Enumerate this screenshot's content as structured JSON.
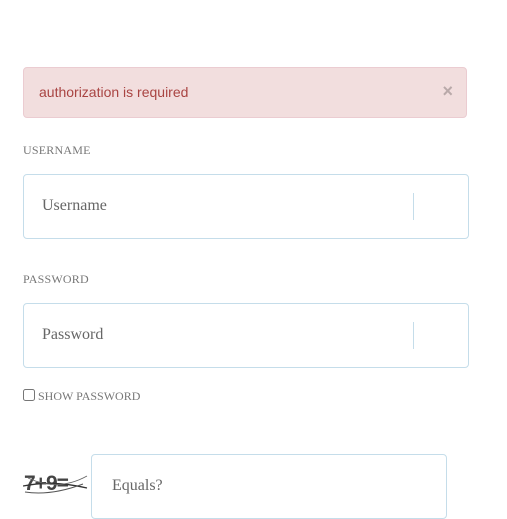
{
  "alert": {
    "message": "authorization is required",
    "close_symbol": "×",
    "background_color": "#f2dede",
    "text_color": "#a94442"
  },
  "username": {
    "label": "USERNAME",
    "placeholder": "Username",
    "value": ""
  },
  "password": {
    "label": "PASSWORD",
    "placeholder": "Password",
    "value": ""
  },
  "show_password": {
    "label": "SHOW PASSWORD",
    "checked": false
  },
  "captcha": {
    "image_text": "7+9=",
    "placeholder": "Equals?",
    "value": ""
  }
}
